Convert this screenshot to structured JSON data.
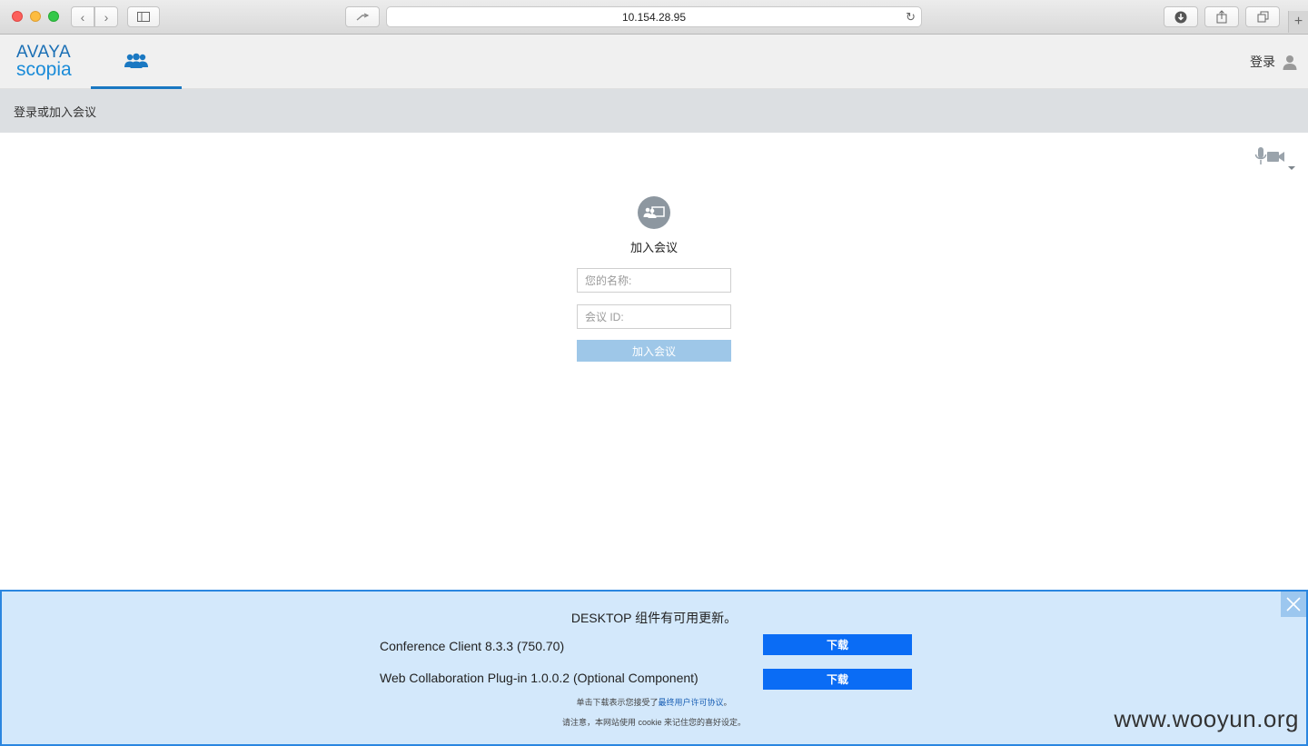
{
  "browser": {
    "address": "10.154.28.95"
  },
  "header": {
    "logo_line1": "AVAYA",
    "logo_line2": "scopia",
    "nav_tab_icon": "people-icon",
    "login_label": "登录",
    "user_icon": "user-icon"
  },
  "breadcrumb": {
    "text": "登录或加入会议"
  },
  "join": {
    "icon": "join-meeting-icon",
    "title": "加入会议",
    "name_placeholder": "您的名称:",
    "name_value": "",
    "meeting_id_placeholder": "会议 ID:",
    "meeting_id_value": "",
    "button_label": "加入会议"
  },
  "banner": {
    "title": "DESKTOP 组件有可用更新。",
    "rows": [
      {
        "label": "Conference Client 8.3.3 (750.70)",
        "button": "下载"
      },
      {
        "label": "Web Collaboration Plug-in 1.0.0.2 (Optional Component)",
        "button": "下载"
      }
    ],
    "license_prefix": "单击下载表示您接受了",
    "license_link": "最终用户许可协议",
    "license_suffix": "。",
    "cookie_note": "请注意，本网站使用 cookie 来记住您的喜好设定。",
    "watermark": "www.wooyun.org"
  },
  "colors": {
    "accent": "#1a78c2",
    "download_button": "#0a6cf5",
    "join_button_disabled": "#9ec7e8",
    "banner_bg": "#d3e8fb"
  }
}
